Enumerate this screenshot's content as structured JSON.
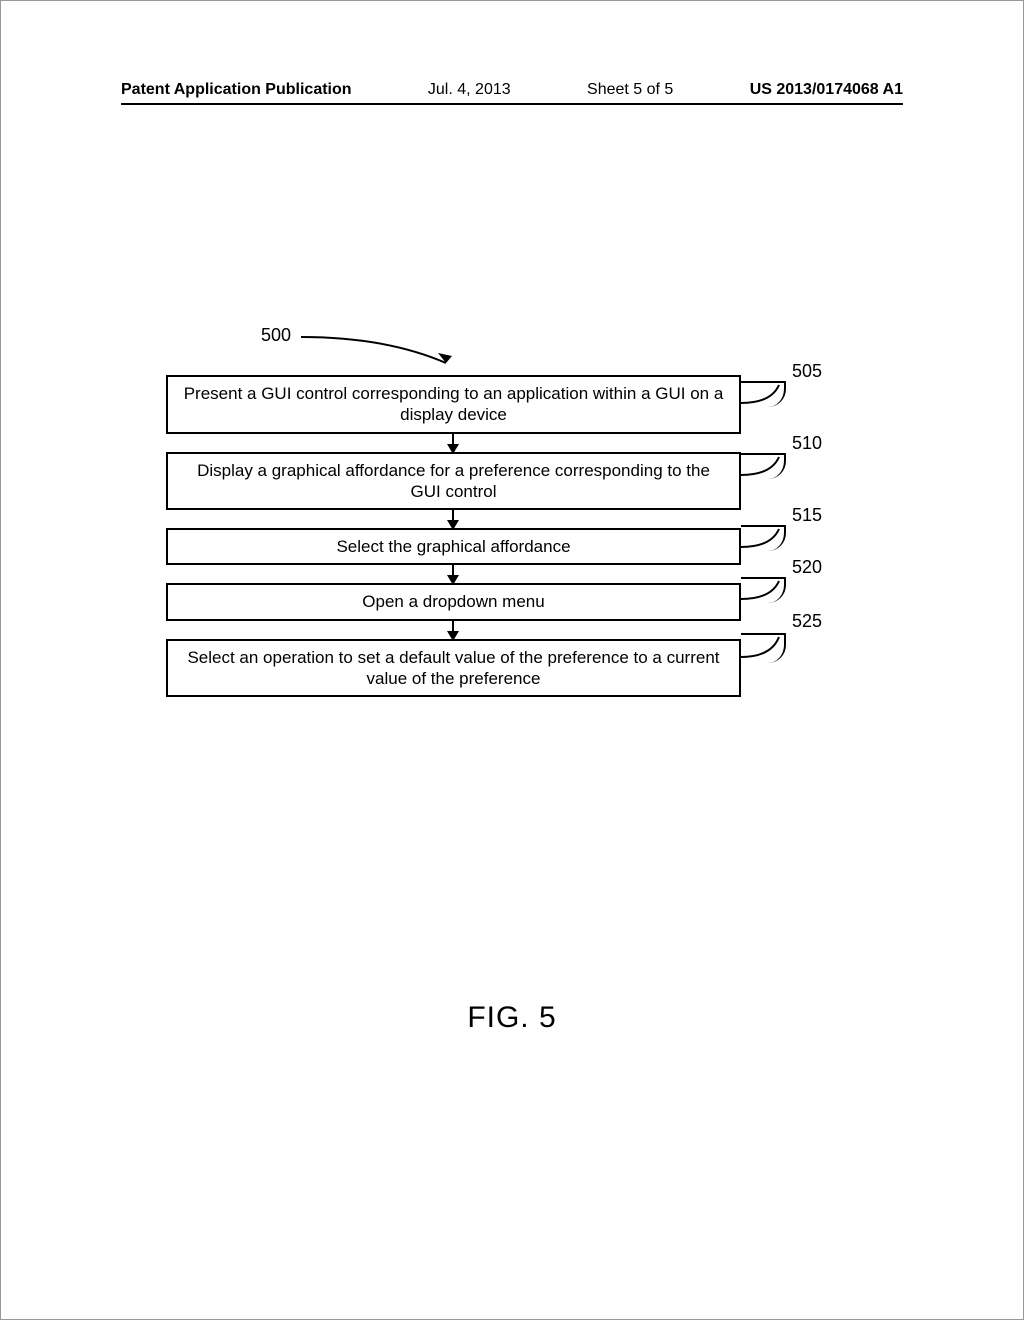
{
  "header": {
    "publication_label": "Patent Application Publication",
    "date": "Jul. 4, 2013",
    "sheet": "Sheet 5 of 5",
    "pub_number": "US 2013/0174068 A1"
  },
  "diagram": {
    "start_ref": "500",
    "steps": [
      {
        "ref": "505",
        "text": "Present a GUI control corresponding to an application within a GUI on a display device"
      },
      {
        "ref": "510",
        "text": "Display a graphical affordance for a preference corresponding to the GUI control"
      },
      {
        "ref": "515",
        "text": "Select the graphical affordance"
      },
      {
        "ref": "520",
        "text": "Open a dropdown menu"
      },
      {
        "ref": "525",
        "text": "Select an operation to set a default value of the preference to a current value of the preference"
      }
    ]
  },
  "figure_caption": "FIG. 5"
}
